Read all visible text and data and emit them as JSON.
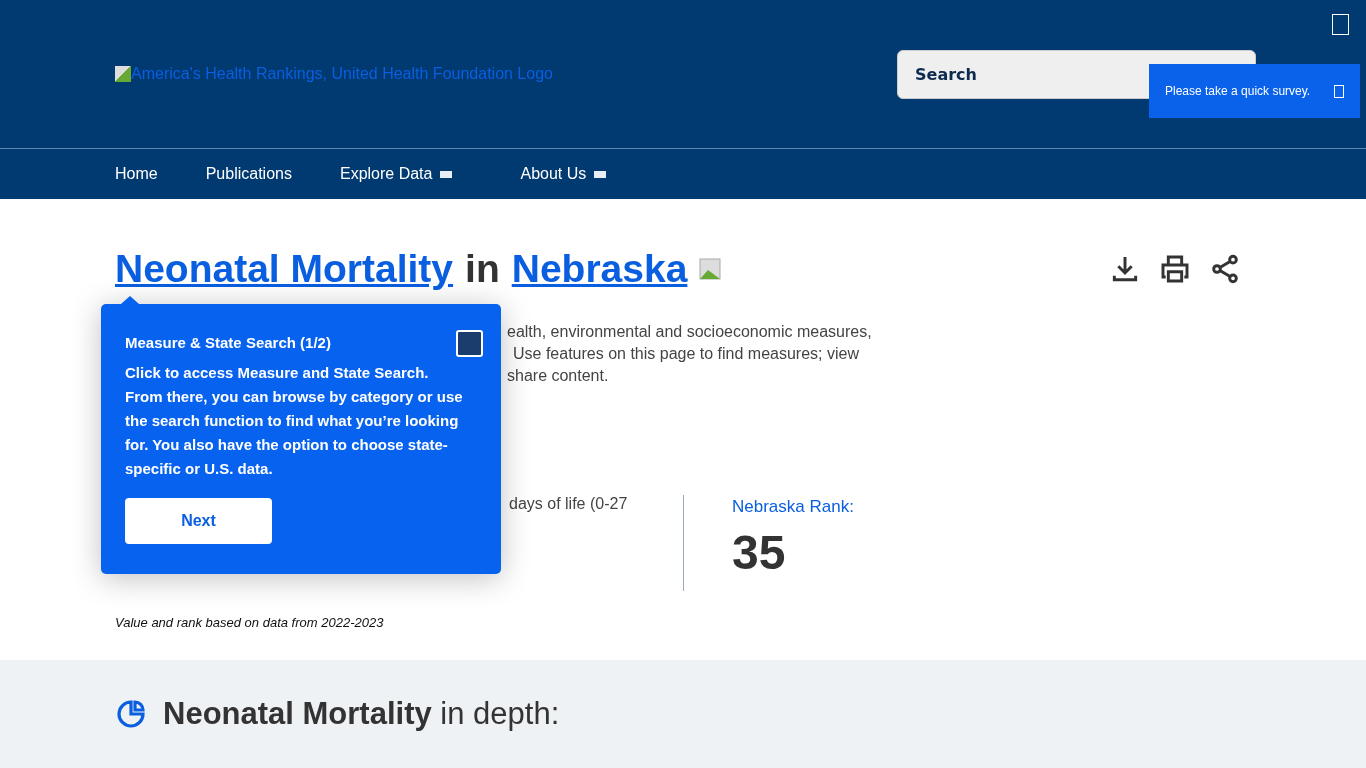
{
  "header": {
    "logo_alt": "America's Health Rankings, United Health Foundation Logo",
    "search": {
      "placeholder": "Search"
    }
  },
  "survey": {
    "text": "Please take a quick survey."
  },
  "nav": [
    {
      "label": "Home",
      "dropdown": false
    },
    {
      "label": "Publications",
      "dropdown": false
    },
    {
      "label": "Explore Data",
      "dropdown": true
    },
    {
      "label": "About Us",
      "dropdown": true
    }
  ],
  "title": {
    "measure": "Neonatal Mortality",
    "connector": "in",
    "state": "Nebraska"
  },
  "description_lines": [
    "ealth, environmental and socioeconomic measures,",
    "Use features on this page to find measures; view",
    "share content."
  ],
  "measure_definition": "days of life (0-27",
  "rank": {
    "label": "Nebraska Rank:",
    "value": "35"
  },
  "data_note": "Value and rank based on data from 2022-2023",
  "popover": {
    "title": "Measure & State Search (1/2)",
    "body": "Click to access Measure and State Search. From there, you can browse by category or use the search function to find what you’re looking for. You also have the option to choose state-specific or U.S. data.",
    "button": "Next"
  },
  "in_depth": {
    "measure": "Neonatal Mortality",
    "rest": "in depth:"
  }
}
